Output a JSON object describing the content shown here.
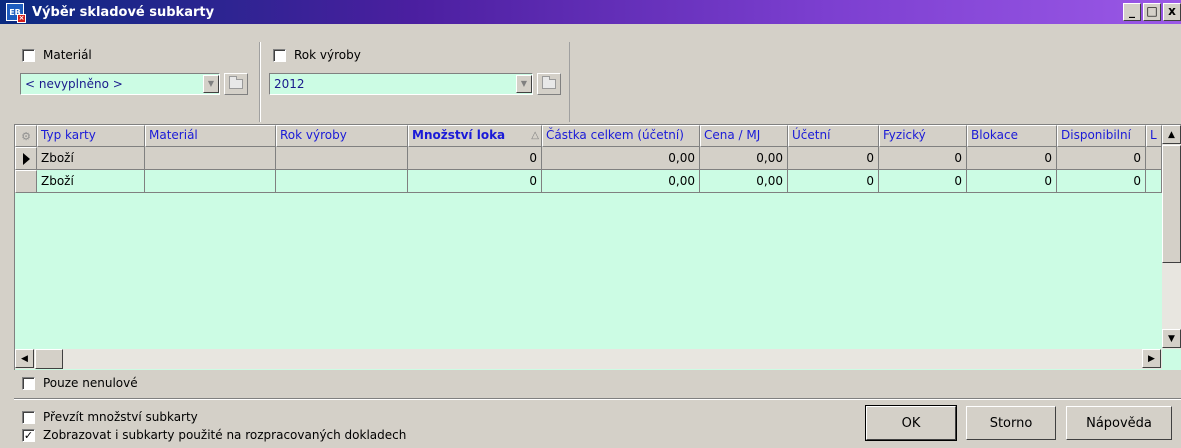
{
  "window": {
    "title": "Výběr skladové subkarty",
    "icon_text": "EB",
    "buttons": [
      "_",
      "□",
      "x"
    ]
  },
  "filters": {
    "material": {
      "checkbox_label": "Materiál",
      "checked": false,
      "value": "< nevyplněno >"
    },
    "year": {
      "checkbox_label": "Rok výroby",
      "checked": false,
      "value": "2012"
    }
  },
  "grid": {
    "columns": [
      "Typ karty",
      "Materiál",
      "Rok výroby",
      "Množství loka",
      "Částka celkem (účetní)",
      "Cena / MJ",
      "Účetní",
      "Fyzický",
      "Blokace",
      "Disponibilní",
      "L"
    ],
    "sorted_column": "Množství loka",
    "rows": [
      [
        "Zboží",
        "",
        "",
        "0",
        "0,00",
        "0,00",
        "0",
        "0",
        "0",
        "0",
        ""
      ],
      [
        "Zboží",
        "",
        "",
        "0",
        "0,00",
        "0,00",
        "0",
        "0",
        "0",
        "0",
        ""
      ]
    ]
  },
  "options": {
    "nonzero_only": {
      "label": "Pouze nenulové",
      "checked": false
    },
    "take_quantity": {
      "label": "Převzít množství subkarty",
      "checked": false
    },
    "show_in_progress": {
      "label": "Zobrazovat i subkarty použité na rozpracovaných dokladech",
      "checked": true
    }
  },
  "buttons": {
    "ok": "OK",
    "cancel": "Storno",
    "help": "Nápověda"
  },
  "colors": {
    "grid_background": "#ccfce4",
    "header_text": "#1a1ad8",
    "title_gradient_start": "#0a2a80",
    "title_gradient_end": "#9a58e6"
  }
}
